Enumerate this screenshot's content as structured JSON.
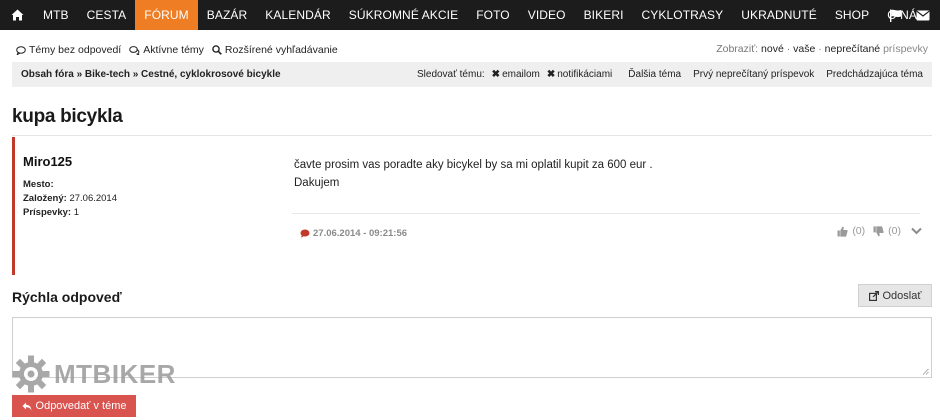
{
  "nav": {
    "items": [
      {
        "label": "MTB",
        "active": false
      },
      {
        "label": "CESTA",
        "active": false
      },
      {
        "label": "FÓRUM",
        "active": true
      },
      {
        "label": "BAZÁR",
        "active": false
      },
      {
        "label": "KALENDÁR",
        "active": false
      },
      {
        "label": "SÚKROMNÉ AKCIE",
        "active": false
      },
      {
        "label": "FOTO",
        "active": false
      },
      {
        "label": "VIDEO",
        "active": false
      },
      {
        "label": "BIKERI",
        "active": false
      },
      {
        "label": "CYKLOTRASY",
        "active": false
      },
      {
        "label": "UKRADNUTÉ",
        "active": false
      },
      {
        "label": "SHOP",
        "active": false
      },
      {
        "label": "O NÁS",
        "active": false
      }
    ],
    "active_color": "#ee7d24",
    "bg_color": "#1c1c1c",
    "icons": [
      "home-icon",
      "flag-icon",
      "envelope-icon"
    ]
  },
  "sublinks": {
    "unanswered": "Témy bez odpovedí",
    "active": "Aktívne témy",
    "advanced_search": "Rozšírené vyhľadávanie",
    "show_label": "Zobraziť:",
    "show_new": "nové",
    "show_yours": "vaše",
    "show_unread": "neprečítané",
    "show_posts": "príspevky"
  },
  "breadcrumb": {
    "text": "Obsah fóra » Bike-tech » Cestné, cyklokrosové bicykle",
    "follow_label": "Sledovať tému:",
    "follow_email": "emailom",
    "follow_notif": "notifikáciami",
    "next_topic": "Ďalšia téma",
    "first_unread": "Prvý neprečítaný príspevok",
    "prev_topic": "Predchádzajúca téma"
  },
  "topic": {
    "title": "kupa bicykla"
  },
  "post": {
    "author": "Miro125",
    "city_label": "Mesto:",
    "created_label": "Založený:",
    "created_value": "27.06.2014",
    "posts_label": "Príspevky:",
    "posts_value": "1",
    "body_line1": "čavte prosim vas poradte aky bicykel by sa mi oplatil kupit za 600 eur .",
    "body_line2": "Dakujem",
    "date": "27.06.2014 - 09:21:56",
    "likes": "(0)",
    "dislikes": "(0)",
    "accent_color": "#c0392b"
  },
  "quick_reply": {
    "title": "Rýchla odpoveď",
    "send_label": "Odoslať",
    "textarea_value": ""
  },
  "logo": {
    "text": "MTBIKER"
  },
  "reply_button": {
    "label": "Odpovedať v téme",
    "color": "#d9534f"
  }
}
